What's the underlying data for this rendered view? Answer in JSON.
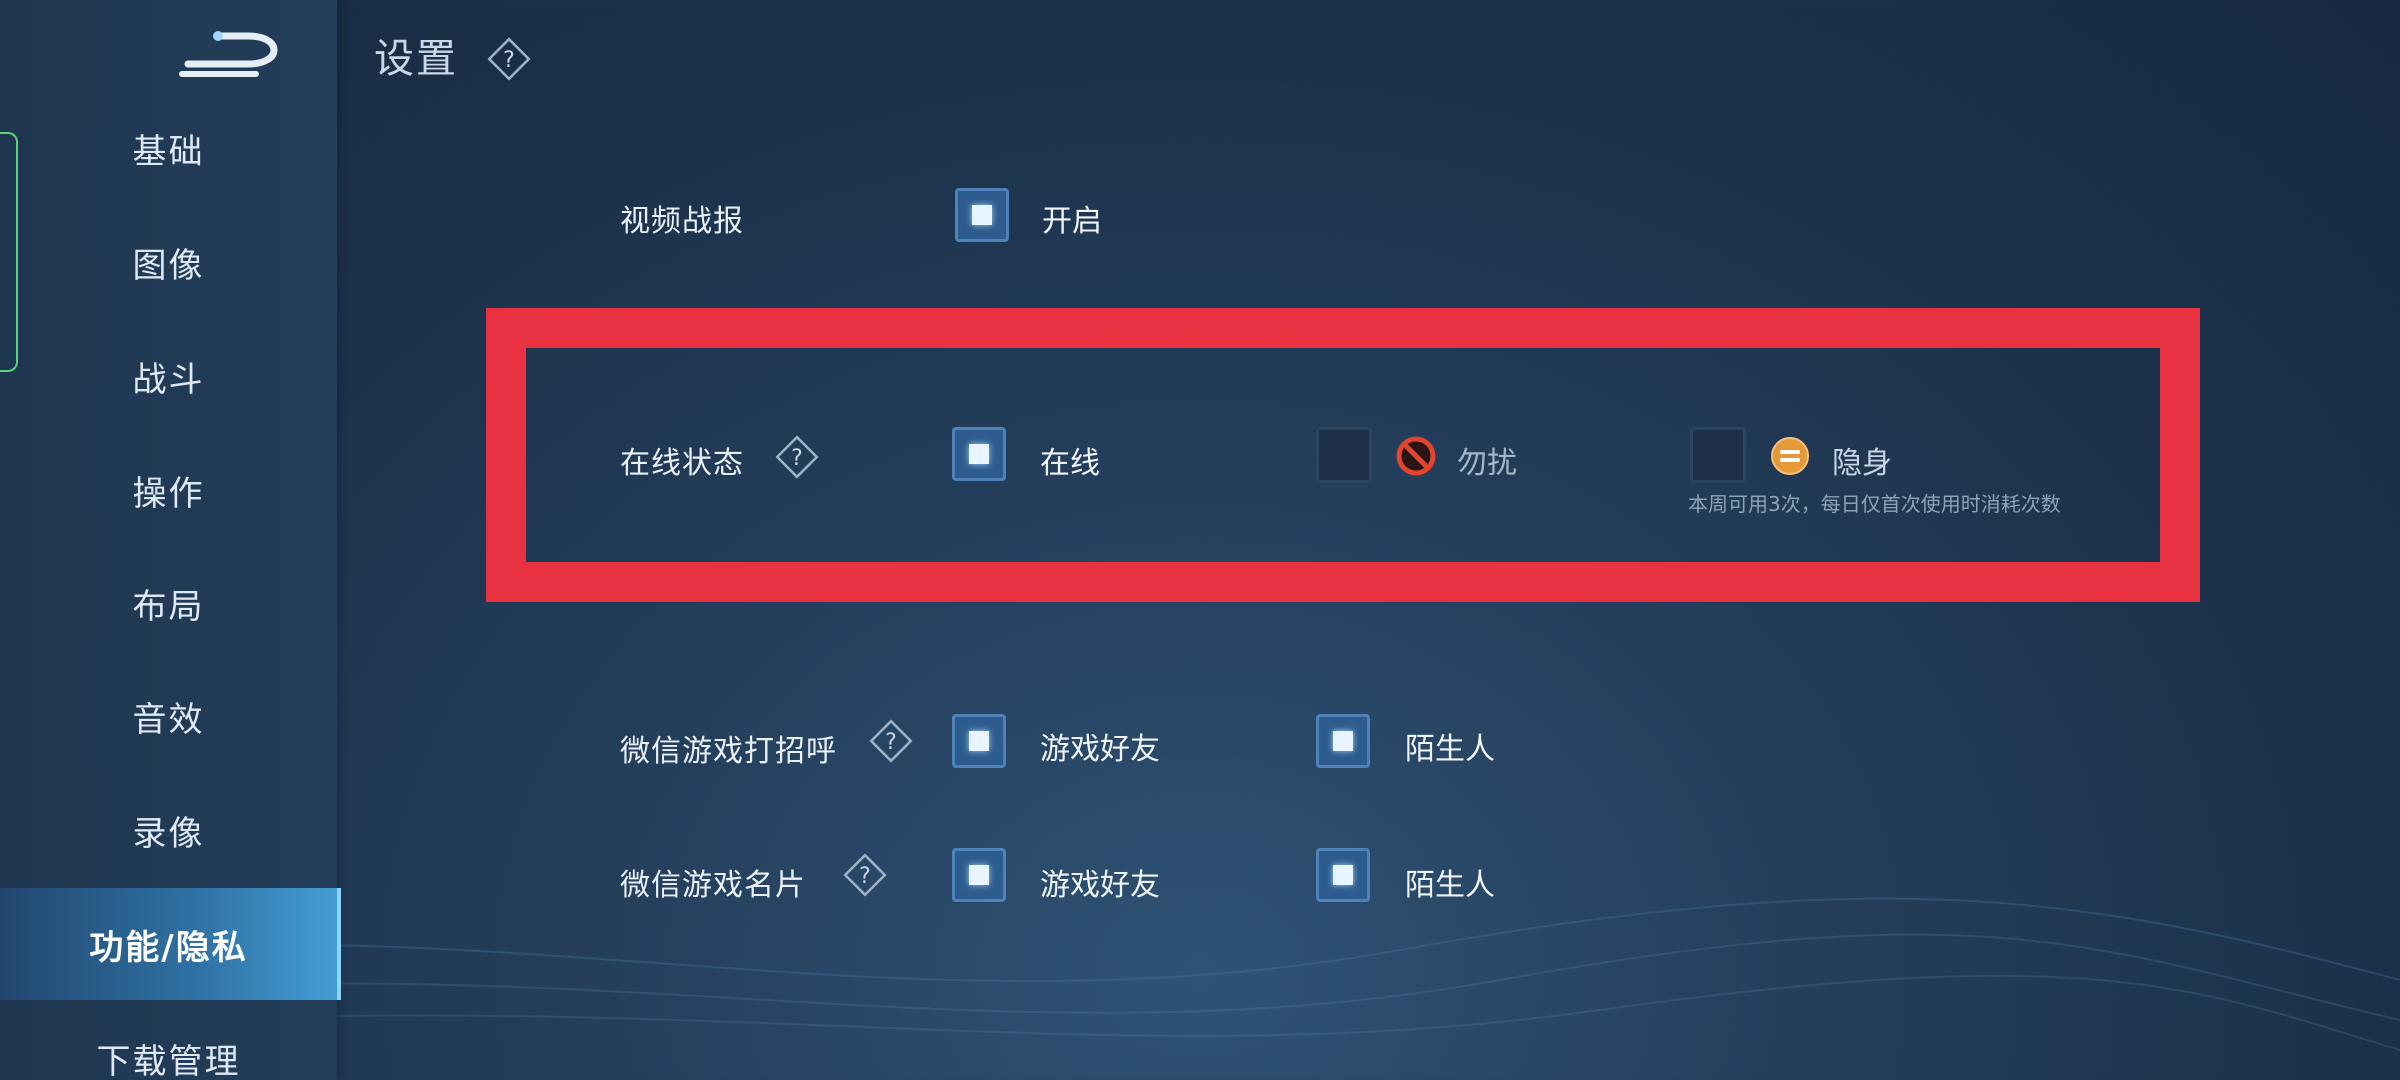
{
  "page": {
    "title": "设置"
  },
  "sidebar": {
    "items": [
      {
        "label": "基础"
      },
      {
        "label": "图像"
      },
      {
        "label": "战斗"
      },
      {
        "label": "操作"
      },
      {
        "label": "布局"
      },
      {
        "label": "音效"
      },
      {
        "label": "录像"
      },
      {
        "label": "功能/隐私",
        "active": true
      },
      {
        "label": "下载管理"
      }
    ]
  },
  "settings": {
    "video_report": {
      "label": "视频战报",
      "option": "开启",
      "checked": true
    },
    "online_status": {
      "label": "在线状态",
      "options": [
        {
          "label": "在线",
          "checked": true
        },
        {
          "label": "勿扰",
          "checked": false,
          "icon": "no-disturb-icon"
        },
        {
          "label": "隐身",
          "checked": false,
          "icon": "invisible-icon"
        }
      ],
      "note": "本周可用3次，每日仅首次使用时消耗次数"
    },
    "wechat_greeting": {
      "label": "微信游戏打招呼",
      "options": [
        {
          "label": "游戏好友",
          "checked": true
        },
        {
          "label": "陌生人",
          "checked": true
        }
      ]
    },
    "wechat_card": {
      "label": "微信游戏名片",
      "options": [
        {
          "label": "游戏好友",
          "checked": true
        },
        {
          "label": "陌生人",
          "checked": true
        }
      ]
    }
  },
  "colors": {
    "highlight": "#e83242",
    "background": "#1f3650",
    "accent": "#4e82b8"
  }
}
